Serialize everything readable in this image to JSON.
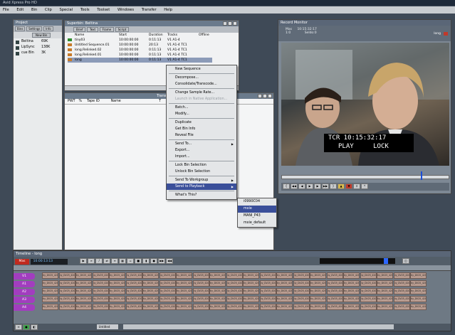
{
  "app": {
    "title": "Avid Xpress Pro HD",
    "menu": [
      "File",
      "Edit",
      "Bin",
      "Clip",
      "Special",
      "Tools",
      "Toolset",
      "Windows",
      "Transfer",
      "Help"
    ]
  },
  "project_window": {
    "title": "Project",
    "tabs": [
      "Bins",
      "Settings",
      "Info"
    ],
    "new_bin": "New Bin",
    "bins": [
      {
        "name": "Beltina",
        "size": "69K"
      },
      {
        "name": "LipSync",
        "size": "138K"
      },
      {
        "name": "cue Bin",
        "size": "3K"
      }
    ]
  },
  "bin_window": {
    "title": "Superbin: Beltina",
    "tabs": [
      "Brief",
      "Text",
      "Frame",
      "Script"
    ],
    "columns": [
      "Name",
      "Start",
      "Duration",
      "Tracks",
      "Offline"
    ],
    "rows": [
      {
        "name": "tiny03",
        "start": "10:00:00:00",
        "duration": "0:11:13",
        "tracks": "V1 A1-4"
      },
      {
        "name": "Untitled Sequence.01",
        "start": "10:00:00:00",
        "duration": "20:13",
        "tracks": "V1 A1-4 TC1"
      },
      {
        "name": "long.Relinked.02",
        "start": "10:00:00:00",
        "duration": "0:11:13",
        "tracks": "V1 A1-4 TC1"
      },
      {
        "name": "long.Relinked.01",
        "start": "10:00:00:00",
        "duration": "0:11:13",
        "tracks": "V1 A1-4 TC1"
      },
      {
        "name": "long",
        "start": "10:00:00:00",
        "duration": "0:11:13",
        "tracks": "V1 A1-4 TC1"
      }
    ]
  },
  "transfer_window": {
    "title": "Transfer Status",
    "columns": [
      "PWT",
      "%",
      "Tape ID",
      "Name",
      "T"
    ]
  },
  "context_menu": {
    "groups": [
      [
        {
          "label": "New Sequence"
        }
      ],
      [
        {
          "label": "Decompose..."
        },
        {
          "label": "Consolidate/Transcode..."
        }
      ],
      [
        {
          "label": "Change Sample Rate..."
        },
        {
          "label": "Launch in Native Application...",
          "disabled": true
        }
      ],
      [
        {
          "label": "Batch..."
        },
        {
          "label": "Modify..."
        }
      ],
      [
        {
          "label": "Duplicate"
        },
        {
          "label": "Get Bin Info"
        },
        {
          "label": "Reveal File"
        }
      ],
      [
        {
          "label": "Send To...",
          "submenu": true
        },
        {
          "label": "Export..."
        },
        {
          "label": "Import..."
        }
      ],
      [
        {
          "label": "Lock Bin Selection"
        },
        {
          "label": "Unlock Bin Selection"
        }
      ],
      [
        {
          "label": "Send To Workgroup",
          "submenu": true
        },
        {
          "label": "Send to Playback",
          "submenu": true,
          "selected": true
        }
      ],
      [
        {
          "label": "What's This?"
        }
      ]
    ]
  },
  "submenu": {
    "items": [
      {
        "label": "i0990C04"
      },
      {
        "label": "mxie",
        "selected": true
      },
      {
        "label": "MANI_P43"
      },
      {
        "label": "mxie_default"
      }
    ]
  },
  "viewer": {
    "title": "Record Monitor",
    "top_labels": [
      "Mas",
      "1:0",
      "10:15:32:17",
      "Seldo:0"
    ],
    "sequence_name": "long",
    "overlay_tc": "TCR 10:15:32:17",
    "overlay_play": "PLAY",
    "overlay_lock": "LOCK"
  },
  "timeline": {
    "title": "Timeline - long",
    "timecode": "10:00:13:13",
    "mas": "Mas",
    "tracks": [
      "V1",
      "A1",
      "A2",
      "A3",
      "A4"
    ],
    "clip_label": "tiy_DV25_420",
    "zoom": "Untitled"
  },
  "colors": {
    "accent": "#3a4f9a",
    "track_purple": "#a23dbf",
    "clip": "#b99c90"
  }
}
